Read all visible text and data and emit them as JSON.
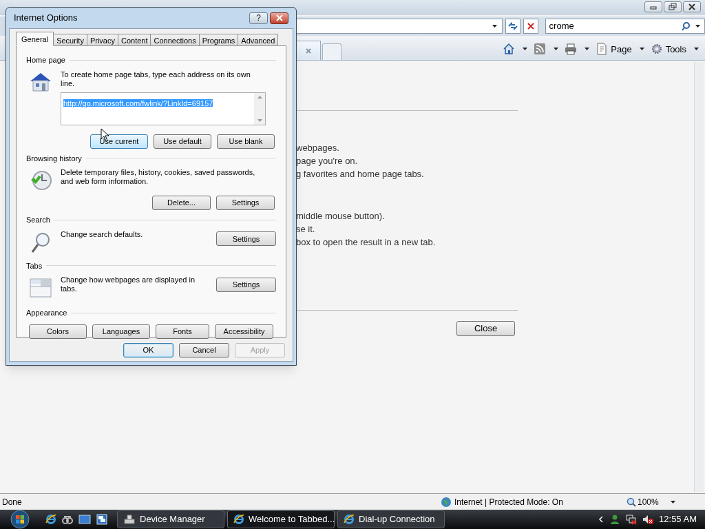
{
  "browser": {
    "search_field": {
      "value": "crome"
    },
    "command_bar": [
      {
        "kind": "home"
      },
      {
        "kind": "feeds"
      },
      {
        "kind": "print"
      },
      {
        "kind": "page",
        "label": "Page"
      },
      {
        "kind": "tools",
        "label": "Tools"
      }
    ],
    "content_groups": [
      {
        "lines": [
          "webpages.",
          "page you're on.",
          "g favorites and home page tabs."
        ]
      },
      {
        "lines": [
          "middle mouse button).",
          "se it.",
          "box to open the result in a new tab."
        ]
      }
    ],
    "close_button": "Close",
    "status_bar": {
      "text": "Done",
      "zone": "Internet | Protected Mode: On",
      "zoom": "100%"
    }
  },
  "dialog": {
    "title": "Internet Options",
    "help": "?",
    "tabs": [
      {
        "label": "General",
        "selected": true
      },
      {
        "label": "Security",
        "selected": false
      },
      {
        "label": "Privacy",
        "selected": false
      },
      {
        "label": "Content",
        "selected": false
      },
      {
        "label": "Connections",
        "selected": false
      },
      {
        "label": "Programs",
        "selected": false
      },
      {
        "label": "Advanced",
        "selected": false
      }
    ],
    "sections": [
      {
        "kind": "home",
        "heading": "Home page",
        "description": "To create home page tabs, type each address on its own line.",
        "url": "http://go.microsoft.com/fwlink/?LinkId=69157",
        "buttons": [
          {
            "label": "Use current",
            "hovered": true
          },
          {
            "label": "Use default",
            "hovered": false
          },
          {
            "label": "Use blank",
            "hovered": false
          }
        ]
      },
      {
        "kind": "history",
        "heading": "Browsing history",
        "description": "Delete temporary files, history, cookies, saved passwords, and web form information.",
        "buttons": [
          {
            "label": "Delete...",
            "hovered": false
          },
          {
            "label": "Settings",
            "hovered": false
          }
        ]
      },
      {
        "kind": "search",
        "heading": "Search",
        "description": "Change search defaults.",
        "buttons": [
          {
            "label": "Settings",
            "hovered": false
          }
        ]
      },
      {
        "kind": "tabs",
        "heading": "Tabs",
        "description": "Change how webpages are displayed in tabs.",
        "buttons": [
          {
            "label": "Settings",
            "hovered": false
          }
        ]
      },
      {
        "kind": "appearance",
        "heading": "Appearance",
        "buttons": [
          {
            "label": "Colors",
            "hovered": false
          },
          {
            "label": "Languages",
            "hovered": false
          },
          {
            "label": "Fonts",
            "hovered": false
          },
          {
            "label": "Accessibility",
            "hovered": false
          }
        ]
      }
    ],
    "footer": [
      {
        "label": "OK",
        "default": true,
        "disabled": false
      },
      {
        "label": "Cancel",
        "default": false,
        "disabled": false
      },
      {
        "label": "Apply",
        "default": false,
        "disabled": true
      }
    ]
  },
  "taskbar": {
    "buttons": [
      {
        "label": "Device Manager",
        "kind": "device",
        "selected": false
      },
      {
        "label": "Welcome to Tabbed...",
        "kind": "ie",
        "selected": true
      },
      {
        "label": "Dial-up Connection",
        "kind": "ie",
        "selected": false
      }
    ],
    "clock": "12:55 AM"
  }
}
